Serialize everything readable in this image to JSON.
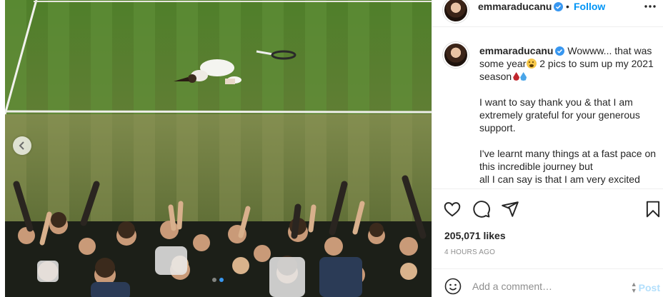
{
  "post": {
    "username": "emmaraducanu",
    "follow_label": "Follow",
    "separator": "•",
    "caption": {
      "line1": "Wowww... that was some year",
      "line1b": " 2 pics to sum up my 2021 season",
      "p2": "I want to say thank you & that I am extremely grateful for your generous support.",
      "p3a": "I've learnt many things at a fast pace on this incredible journey but",
      "p3b": "all I can say is that I am very excited and"
    },
    "likes": "205,071 likes",
    "time": "4 HOURS AGO",
    "comment_placeholder": "Add a comment…",
    "post_label": "Post",
    "carousel": {
      "slides": 2,
      "active": 2
    }
  },
  "icons": [
    "verified-badge",
    "more-options-icon",
    "heart-icon",
    "comment-icon",
    "share-icon",
    "bookmark-icon",
    "emoji-icon",
    "chevron-left-icon"
  ],
  "colors": {
    "accent": "#0095f6",
    "post_disabled": "#b2dffc",
    "verified": "#3897f0",
    "muted": "#8e8e8e"
  }
}
